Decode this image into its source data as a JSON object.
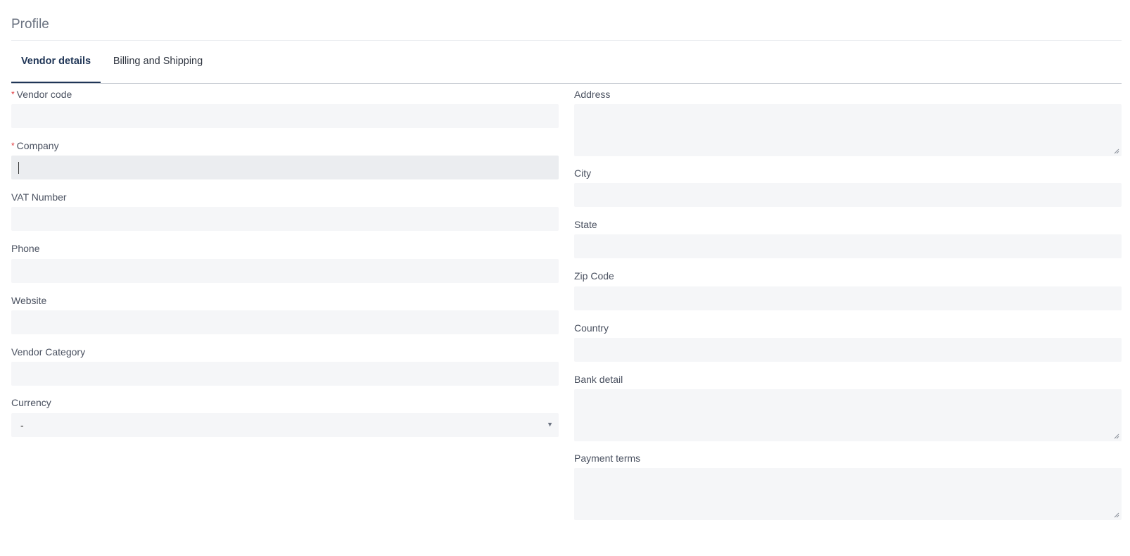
{
  "page": {
    "title": "Profile"
  },
  "tabs": [
    {
      "label": "Vendor details",
      "active": true
    },
    {
      "label": "Billing and Shipping",
      "active": false
    }
  ],
  "form": {
    "vendor_code": {
      "label": "Vendor code",
      "required": true,
      "value": ""
    },
    "company": {
      "label": "Company",
      "required": true,
      "value": "",
      "focused": true
    },
    "vat_number": {
      "label": "VAT Number",
      "value": ""
    },
    "phone": {
      "label": "Phone",
      "value": ""
    },
    "website": {
      "label": "Website",
      "value": ""
    },
    "vendor_category": {
      "label": "Vendor Category",
      "value": ""
    },
    "currency": {
      "label": "Currency",
      "selected": "-"
    },
    "address": {
      "label": "Address",
      "value": ""
    },
    "city": {
      "label": "City",
      "value": ""
    },
    "state": {
      "label": "State",
      "value": ""
    },
    "zip_code": {
      "label": "Zip Code",
      "value": ""
    },
    "country": {
      "label": "Country",
      "value": ""
    },
    "bank_detail": {
      "label": "Bank detail",
      "value": ""
    },
    "payment_terms": {
      "label": "Payment terms",
      "value": ""
    }
  },
  "required_marker": "*",
  "icons": {
    "select_arrow": "chevron-down-icon",
    "resize": "resize-handle-icon"
  },
  "colors": {
    "accent": "#1f3556",
    "required": "#e0353a",
    "input_bg": "#f5f6f8"
  }
}
